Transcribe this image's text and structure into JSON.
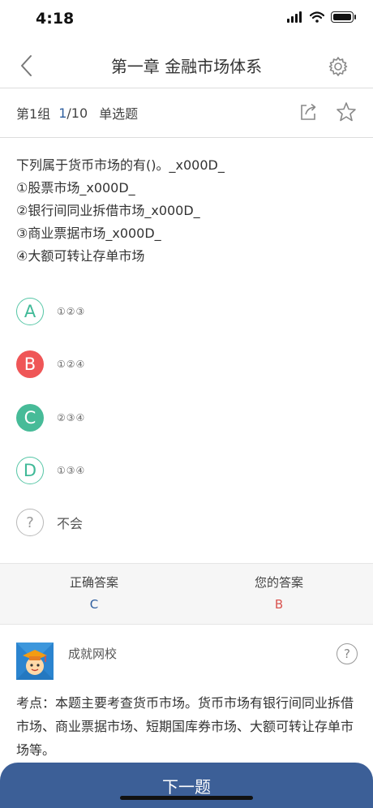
{
  "status_bar": {
    "time": "4:18"
  },
  "nav": {
    "title": "第一章 金融市场体系"
  },
  "info": {
    "group": "第1组",
    "current": "1",
    "total": "/10",
    "type": "单选题"
  },
  "question": {
    "lines": [
      "下列属于货币市场的有()。_x000D_",
      "①股票市场_x000D_",
      "②银行间同业拆借市场_x000D_",
      "③商业票据市场_x000D_",
      "④大额可转让存单市场"
    ]
  },
  "options": [
    {
      "letter": "A",
      "text": "①②③",
      "state": "default"
    },
    {
      "letter": "B",
      "text": "①②④",
      "state": "wrong"
    },
    {
      "letter": "C",
      "text": "②③④",
      "state": "correct"
    },
    {
      "letter": "D",
      "text": "①③④",
      "state": "default"
    },
    {
      "letter": "?",
      "text": "不会",
      "state": "unknown"
    }
  ],
  "answers": {
    "correct_label": "正确答案",
    "correct_value": "C",
    "yours_label": "您的答案",
    "yours_value": "B"
  },
  "analysis": {
    "school": "成就网校",
    "text": "考点：本题主要考查货币市场。货币市场有银行间同业拆借市场、商业票据市场、短期国库券市场、大额可转让存单市场等。"
  },
  "next_button": "下一题",
  "colors": {
    "accent_blue": "#3c5f97",
    "correct_green": "#47bb98",
    "wrong_red": "#ef5657",
    "correct_value": "#2f5f9f",
    "wrong_value": "#d9534f"
  }
}
